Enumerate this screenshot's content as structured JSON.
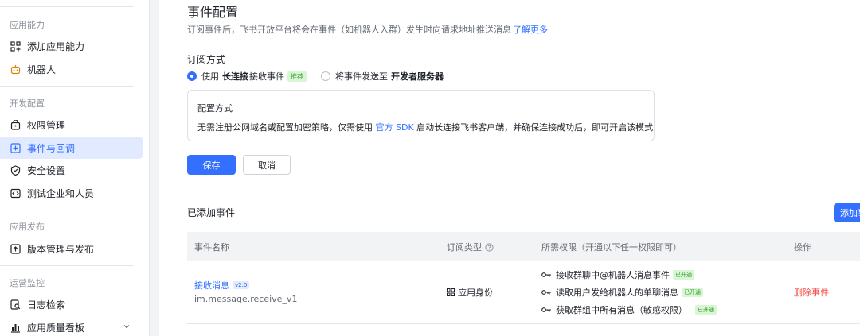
{
  "sidebar": {
    "sections": [
      {
        "title": "应用能力",
        "items": [
          {
            "label": "添加应用能力",
            "icon": "grid-plus-icon"
          },
          {
            "label": "机器人",
            "icon": "robot-icon"
          }
        ]
      },
      {
        "title": "开发配置",
        "items": [
          {
            "label": "权限管理",
            "icon": "permission-icon"
          },
          {
            "label": "事件与回调",
            "icon": "event-icon"
          },
          {
            "label": "安全设置",
            "icon": "shield-icon"
          },
          {
            "label": "测试企业和人员",
            "icon": "code-icon"
          }
        ]
      },
      {
        "title": "应用发布",
        "items": [
          {
            "label": "版本管理与发布",
            "icon": "upload-icon"
          }
        ]
      },
      {
        "title": "运营监控",
        "items": [
          {
            "label": "日志检索",
            "icon": "log-search-icon"
          },
          {
            "label": "应用质量看板",
            "icon": "bar-chart-icon"
          }
        ]
      }
    ],
    "active_item": "事件与回调"
  },
  "page": {
    "title": "事件配置",
    "description": "订阅事件后，飞书开放平台将会在事件（如机器人入群）发生时向请求地址推送消息",
    "learn_more": "了解更多"
  },
  "subscription": {
    "label": "订阅方式",
    "option1": {
      "prefix": "使用",
      "bold": "长连接",
      "suffix": "接收事件",
      "tag": "推荐",
      "checked": true
    },
    "option2": {
      "prefix": "将事件发送至",
      "bold": "开发者服务器",
      "checked": false
    }
  },
  "config": {
    "title": "配置方式",
    "text_before": "无需注册公网域名或配置加密策略，仅需使用",
    "link": "官方 SDK",
    "text_after": "启动长连接飞书客户端，并确保连接成功后，即可开启该模式"
  },
  "buttons": {
    "save": "保存",
    "cancel": "取消",
    "add_event": "添加事件"
  },
  "events": {
    "label": "已添加事件",
    "columns": [
      "事件名称",
      "订阅类型",
      "所需权限（开通以下任一权限即可）",
      "操作"
    ],
    "rows": [
      {
        "name": "接收消息",
        "version": "v2.0",
        "id": "im.message.receive_v1",
        "type": "应用身份",
        "permissions": [
          {
            "label": "接收群聊中@机器人消息事件",
            "status": "已开通"
          },
          {
            "label": "读取用户发给机器人的单聊消息",
            "status": "已开通"
          },
          {
            "label": "获取群组中所有消息（敏感权限）",
            "status": "已开通"
          }
        ],
        "action": "删除事件"
      }
    ]
  },
  "colors": {
    "accent": "#3370ff",
    "success": "#2ea121",
    "danger": "#f54a45"
  }
}
